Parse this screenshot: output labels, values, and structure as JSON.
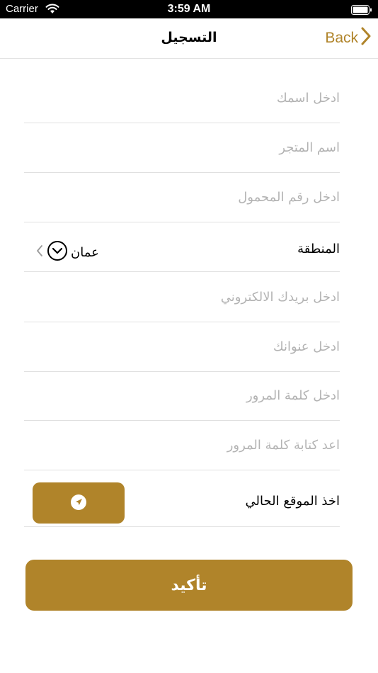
{
  "status_bar": {
    "carrier": "Carrier",
    "time": "3:59 AM"
  },
  "nav": {
    "title": "التسجيل",
    "back_label": "Back"
  },
  "fields": [
    {
      "placeholder": "ادخل اسمك"
    },
    {
      "placeholder": "اسم المتجر"
    },
    {
      "placeholder": "ادخل رقم المحمول"
    },
    {
      "placeholder": "ادخل بريدك الالكتروني"
    },
    {
      "placeholder": "ادخل عنوانك"
    },
    {
      "placeholder": "ادخل كلمة المرور"
    },
    {
      "placeholder": "اعد كتابة كلمة المرور"
    }
  ],
  "region": {
    "label": "المنطقة",
    "value": "عمان"
  },
  "location": {
    "label": "اخذ الموقع الحالي"
  },
  "confirm_label": "تأكيد",
  "colors": {
    "accent": "#b0842a",
    "separator": "#e0e0e0",
    "placeholder": "#b3b3b3"
  }
}
